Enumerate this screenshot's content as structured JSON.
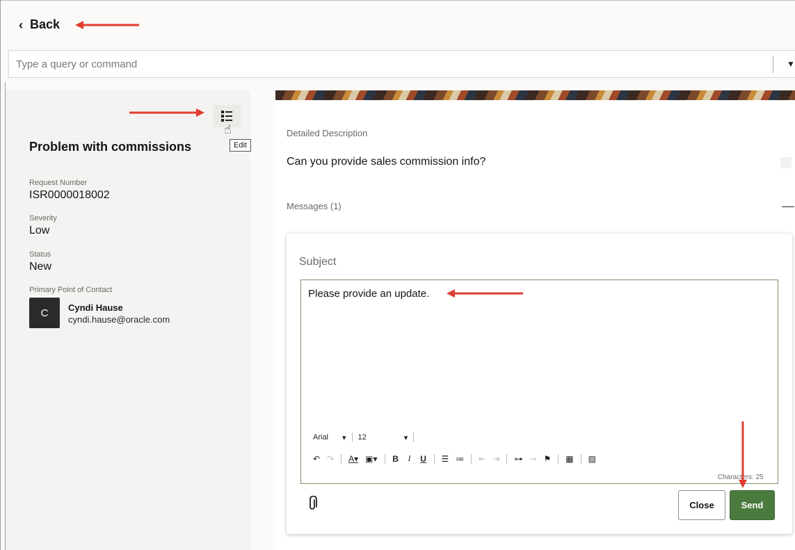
{
  "header": {
    "back_label": "Back",
    "back_icon": "chevron-left-icon"
  },
  "search": {
    "placeholder": "Type a query or command"
  },
  "left_panel": {
    "edit_tooltip": "Edit",
    "title": "Problem with commissions",
    "fields": [
      {
        "label": "Request Number",
        "value": "ISR0000018002"
      },
      {
        "label": "Severity",
        "value": "Low"
      },
      {
        "label": "Status",
        "value": "New"
      },
      {
        "label": "Primary Point of Contact",
        "value": ""
      }
    ],
    "contact": {
      "initial": "C",
      "name": "Cyndi Hause",
      "email": "cyndi.hause@oracle.com"
    }
  },
  "right_panel": {
    "detailed_description_label": "Detailed Description",
    "detailed_description": "Can you provide sales commission info?",
    "messages_label": "Messages (1)",
    "collapse_symbol": "—"
  },
  "message_form": {
    "subject_label": "Subject",
    "body_text": "Please provide an update.",
    "font_family": "Arial",
    "font_size": "12",
    "char_count": "Characters: 25",
    "close_label": "Close",
    "send_label": "Send"
  },
  "colors": {
    "send_button": "#4b7a3e",
    "annotation_arrow": "#e03c31"
  }
}
